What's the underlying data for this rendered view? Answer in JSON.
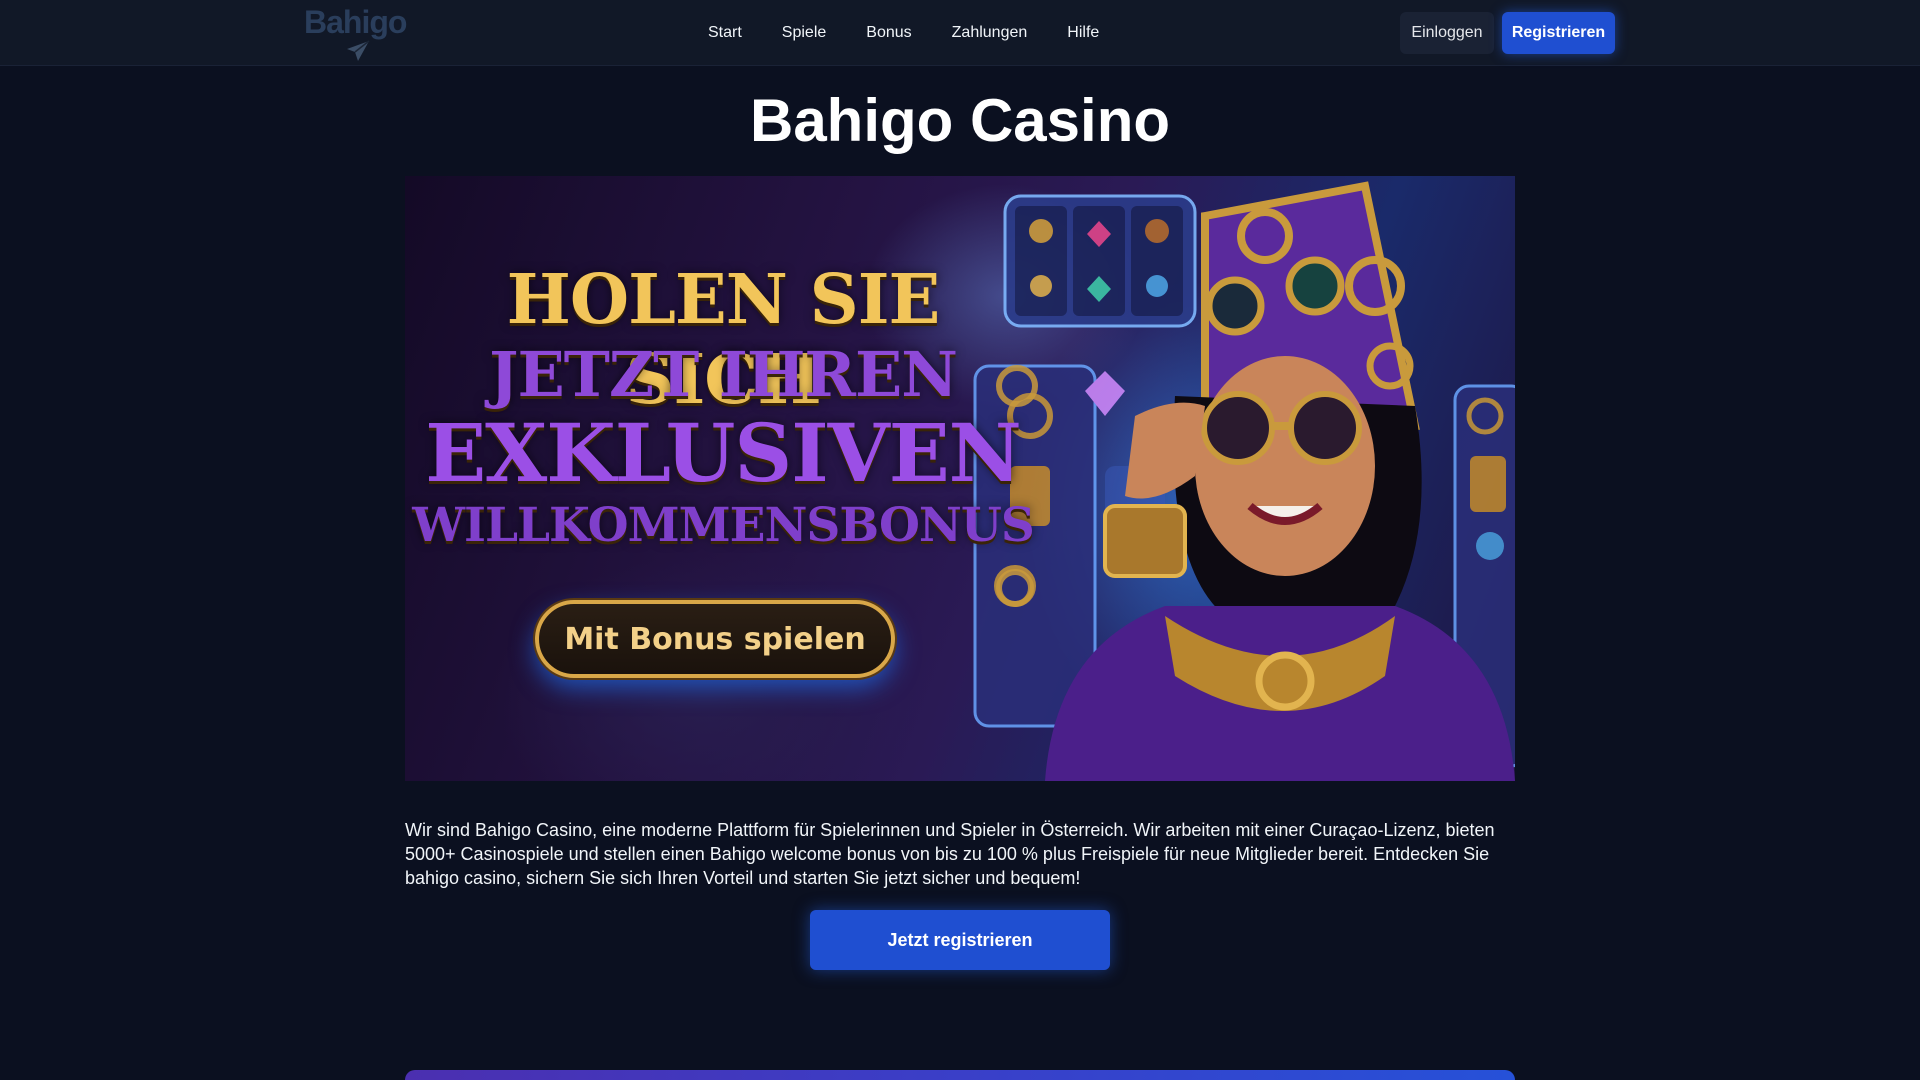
{
  "header": {
    "logo_text": "Bahigo",
    "nav": [
      "Start",
      "Spiele",
      "Bonus",
      "Zahlungen",
      "Hilfe"
    ],
    "login_label": "Einloggen",
    "register_label": "Registrieren"
  },
  "main": {
    "title": "Bahigo Casino",
    "banner": {
      "line1": "HOLEN SIE SICH",
      "line2": "JETZT IHREN",
      "line3": "EXKLUSIVEN",
      "line4": "WILLKOMMENSBONUS",
      "cta_label": "Mit Bonus spielen"
    },
    "intro": "Wir sind Bahigo Casino, eine moderne Plattform für Spielerinnen und Spieler in Österreich. Wir arbeiten mit einer Curaçao-Lizenz, bieten 5000+ Casinospiele und stellen einen Bahigo welcome bonus von bis zu 100 % plus Freispiele für neue Mitglieder bereit. Entdecken Sie bahigo casino, sichern Sie sich Ihren Vorteil und starten Sie jetzt sicher und bequem!",
    "cta_label": "Jetzt registrieren"
  },
  "colors": {
    "background": "#0b1020",
    "header_bg": "#111827",
    "accent_blue": "#1f4fd1",
    "banner_gold": "#f2c55a",
    "banner_purple": "#9b4fe6"
  },
  "icons": {
    "logo_icon": "paper-plane-icon"
  }
}
